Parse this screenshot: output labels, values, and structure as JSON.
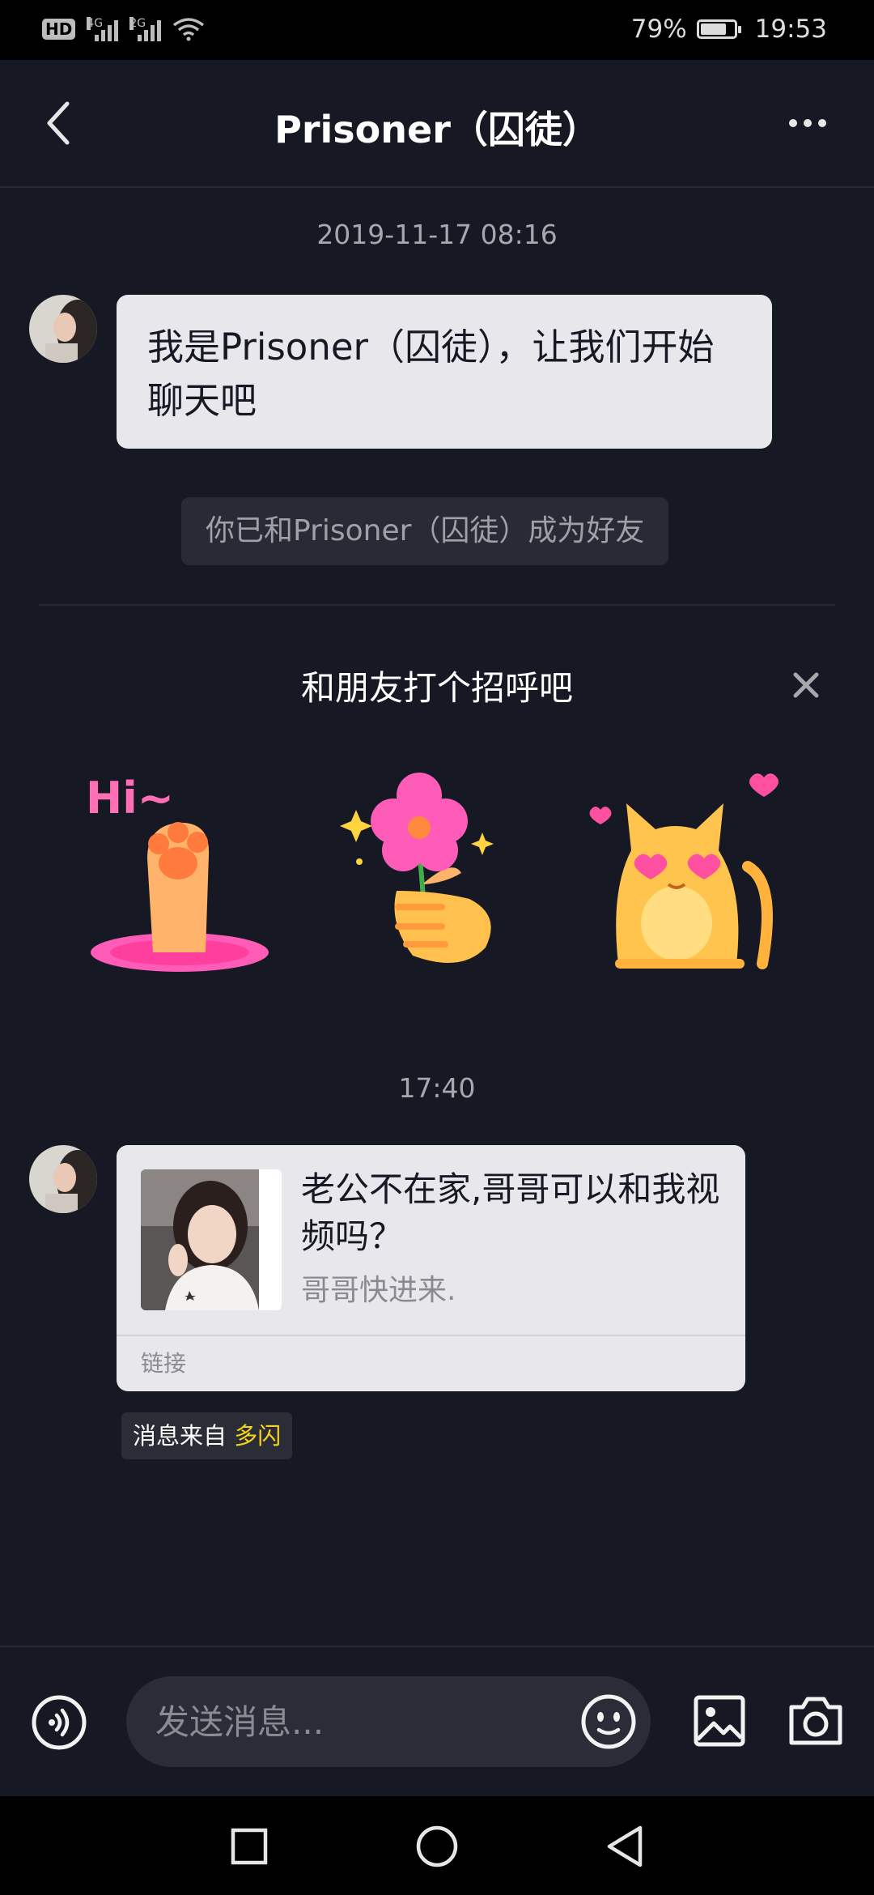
{
  "status_bar": {
    "badge": "HD",
    "sim1_label": "4G",
    "sim2_label": "2G",
    "battery": "79%",
    "battery_level": 0.79,
    "time": "19:53"
  },
  "header": {
    "title": "Prisoner（囚徒）",
    "back_icon": "chevron-left-icon",
    "more_icon": "more-horizontal-icon"
  },
  "chat": {
    "timestamp_1": "2019-11-17 08:16",
    "message_1": "我是Prisoner（囚徒），让我们开始聊天吧",
    "system_notice": "你已和Prisoner（囚徒）成为好友",
    "greeting": {
      "title": "和朋友打个招呼吧",
      "close_icon": "close-icon",
      "stickers": [
        {
          "name": "hi-paw-sticker",
          "text": "Hi~"
        },
        {
          "name": "flower-hand-sticker"
        },
        {
          "name": "heart-eyes-cat-sticker"
        }
      ]
    },
    "timestamp_2": "17:40",
    "link_card": {
      "title": "老公不在家,哥哥可以和我视频吗？",
      "description": "哥哥快进来.",
      "label": "链接"
    },
    "source": {
      "prefix": "消息来自",
      "app": "多闪"
    }
  },
  "input_bar": {
    "placeholder": "发送消息...",
    "icons": [
      "voice-icon",
      "emoji-icon",
      "image-icon",
      "camera-icon"
    ]
  },
  "nav_bar": {
    "icons": [
      "recents-icon",
      "home-icon",
      "back-triangle-icon"
    ]
  },
  "colors": {
    "background": "#161823",
    "bubble": "#e8e8ec",
    "accent_yellow": "#f7d418"
  }
}
